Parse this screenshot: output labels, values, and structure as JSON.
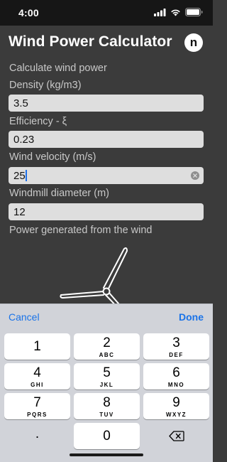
{
  "status_bar": {
    "time": "4:00"
  },
  "header": {
    "title": "Wind Power Calculator",
    "logo_letter": "n"
  },
  "form": {
    "intro": "Calculate wind power",
    "density": {
      "label": "Density (kg/m3)",
      "value": "3.5"
    },
    "efficiency": {
      "label": "Efficiency - ξ",
      "value": "0.23"
    },
    "wind_velocity": {
      "label": "Wind velocity (m/s)",
      "value": "25"
    },
    "windmill_diameter": {
      "label": "Windmill diameter (m)",
      "value": "12"
    },
    "result_label": "Power generated from the wind"
  },
  "keyboard": {
    "toolbar": {
      "cancel": "Cancel",
      "done": "Done"
    },
    "keys": [
      {
        "num": "1",
        "letters": ""
      },
      {
        "num": "2",
        "letters": "ABC"
      },
      {
        "num": "3",
        "letters": "DEF"
      },
      {
        "num": "4",
        "letters": "GHI"
      },
      {
        "num": "5",
        "letters": "JKL"
      },
      {
        "num": "6",
        "letters": "MNO"
      },
      {
        "num": "7",
        "letters": "PQRS"
      },
      {
        "num": "8",
        "letters": "TUV"
      },
      {
        "num": "9",
        "letters": "WXYZ"
      },
      {
        "num": ".",
        "letters": ""
      },
      {
        "num": "0",
        "letters": ""
      }
    ]
  },
  "colors": {
    "background": "#3b3b3b",
    "accent": "#1a73e8",
    "field": "#dedede"
  },
  "icons": [
    "cellular-signal-icon",
    "wifi-icon",
    "battery-icon",
    "clear-field-icon",
    "wind-turbine-icon",
    "backspace-icon"
  ]
}
